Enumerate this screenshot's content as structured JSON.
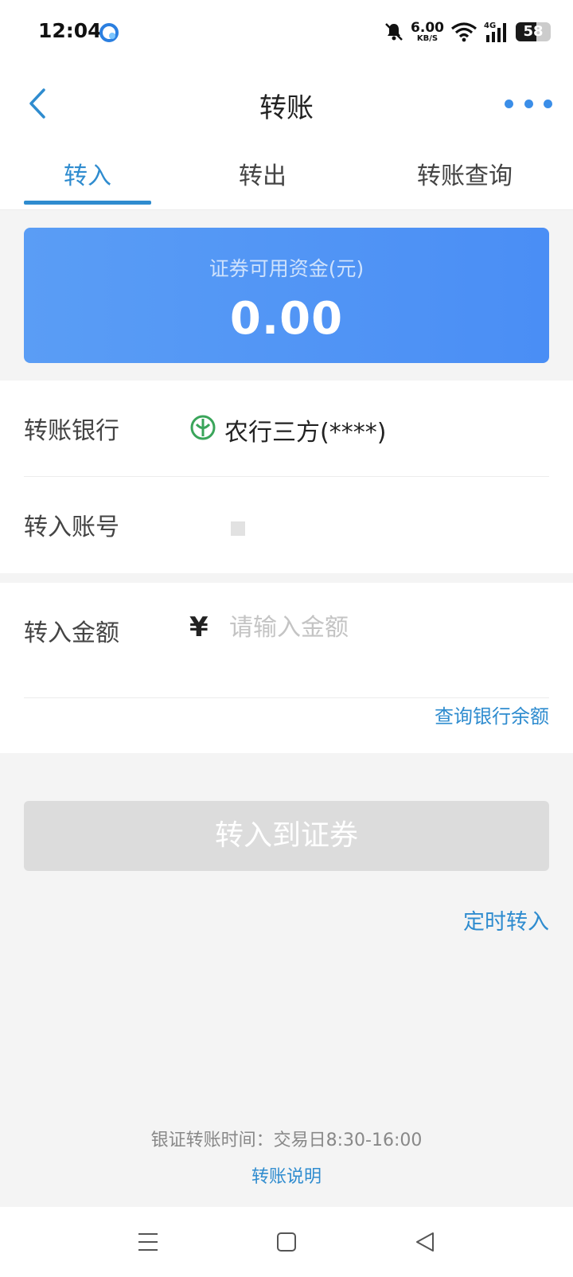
{
  "status_bar": {
    "time": "12:04",
    "net_speed_value": "6.00",
    "net_speed_unit": "KB/S",
    "network_type": "4G",
    "battery": "58",
    "icons": [
      "app-notification-icon",
      "mute-bell-icon",
      "wifi-icon",
      "signal-icon",
      "battery-icon"
    ]
  },
  "header": {
    "title": "转账",
    "back_icon": "chevron-left-icon",
    "more_icon": "more-dots-icon"
  },
  "tabs": [
    {
      "label": "转入",
      "active": true
    },
    {
      "label": "转出",
      "active": false
    },
    {
      "label": "转账查询",
      "active": false
    }
  ],
  "balance": {
    "label": "证券可用资金(元)",
    "value": "0.00"
  },
  "form": {
    "bank_label": "转账银行",
    "bank_name": "农行三方(****)",
    "bank_icon": "abc-bank-logo-icon",
    "account_label": "转入账号",
    "amount_label": "转入金额",
    "currency_symbol": "¥",
    "amount_placeholder": "请输入金额",
    "amount_value": "",
    "query_balance_link": "查询银行余额"
  },
  "actions": {
    "submit_label": "转入到证券",
    "timed_transfer_link": "定时转入"
  },
  "footer": {
    "hours_text": "银证转账时间：交易日8:30-16:00",
    "explain_link": "转账说明"
  },
  "nav_bar": {
    "icons": [
      "menu-icon",
      "home-square-icon",
      "back-triangle-icon"
    ]
  },
  "colors": {
    "accent": "#2f8ccf",
    "card_start": "#5a9df5",
    "card_end": "#4a8ef5",
    "disabled_button": "#dcdcdc",
    "bank_green": "#3aa55a"
  }
}
